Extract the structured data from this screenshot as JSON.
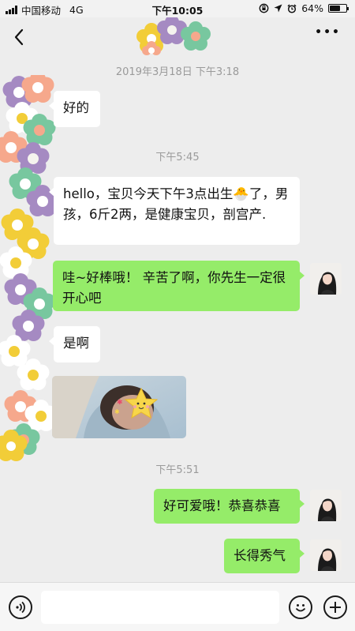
{
  "status_bar": {
    "carrier": "中国移动",
    "network": "4G",
    "time": "下午10:05",
    "battery_text": "64%",
    "battery_level": 0.64
  },
  "nav": {
    "back_icon": "chevron-left-icon",
    "more_label": "•••"
  },
  "messages": [
    {
      "type": "time",
      "text": "2019年3月18日 下午3:18"
    },
    {
      "type": "in",
      "text": "好的"
    },
    {
      "type": "time",
      "text": "下午5:45"
    },
    {
      "type": "in",
      "text": "hello，宝贝今天下午3点出生🐣了，男孩，6斤2两，是健康宝贝，剖宫产."
    },
    {
      "type": "out",
      "text": "哇~好棒哦！ 辛苦了啊，你先生一定很开心吧"
    },
    {
      "type": "in",
      "text": "是啊"
    },
    {
      "type": "in-image",
      "alt": "baby photo with star sticker"
    },
    {
      "type": "time",
      "text": "下午5:51"
    },
    {
      "type": "out",
      "text": "好可爱哦！恭喜恭喜"
    },
    {
      "type": "out",
      "text": "长得秀气"
    }
  ],
  "input_bar": {
    "voice_icon": "voice-icon",
    "emoji_icon": "emoji-icon",
    "plus_icon": "plus-icon",
    "placeholder": ""
  },
  "colors": {
    "background": "#ededed",
    "incoming_bubble": "#ffffff",
    "outgoing_bubble": "#95ec69",
    "timestamp": "#9a9a9a"
  }
}
